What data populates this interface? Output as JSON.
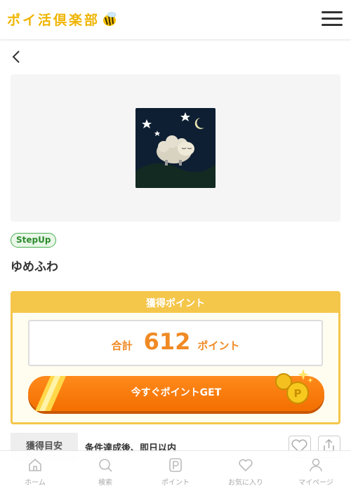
{
  "header": {
    "logo_text": "ポイ活倶楽部",
    "menu_icon": "hamburger-menu-icon"
  },
  "nav": {
    "back_icon": "chevron-left-icon"
  },
  "campaign": {
    "badge": "StepUp",
    "title": "ゆめふわ"
  },
  "points": {
    "heading": "獲得ポイント",
    "total_label": "合計",
    "total_value": "612",
    "total_unit": "ポイント",
    "cta_label": "今すぐポイントGET"
  },
  "info": {
    "tag": "獲得目安",
    "value": "条件達成後、即日以内"
  },
  "actions": {
    "favorite_icon": "heart-icon",
    "share_icon": "share-icon"
  },
  "tabbar": {
    "items": [
      {
        "label": "ホーム",
        "icon": "home-icon"
      },
      {
        "label": "検索",
        "icon": "search-icon"
      },
      {
        "label": "ポイント",
        "icon": "point-icon"
      },
      {
        "label": "お気に入り",
        "icon": "heart-icon"
      },
      {
        "label": "マイページ",
        "icon": "user-icon"
      }
    ]
  },
  "colors": {
    "brand": "#f0b400",
    "accent": "#f36f00",
    "points_border": "#f4c64a",
    "badge_green": "#4caf50"
  }
}
